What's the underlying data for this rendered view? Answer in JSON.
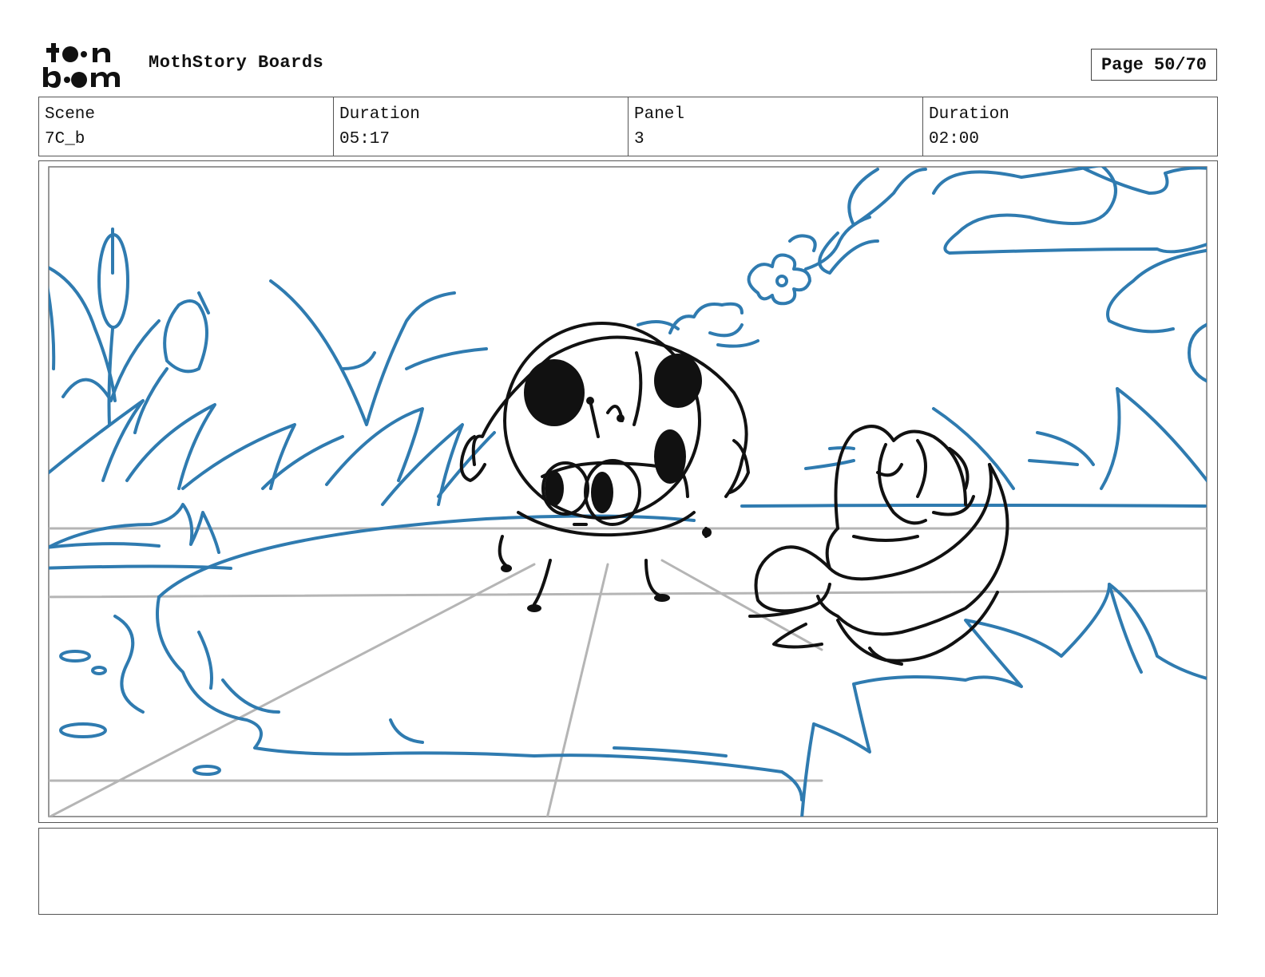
{
  "header": {
    "logo_text": [
      "toon",
      "boom"
    ],
    "title": "MothStory Boards",
    "page": "Page 50/70"
  },
  "info": {
    "scene_label": "Scene",
    "scene_value": "7C_b",
    "scene_duration_label": "Duration",
    "scene_duration_value": "05:17",
    "panel_label": "Panel",
    "panel_value": "3",
    "panel_duration_label": "Duration",
    "panel_duration_value": "02:00"
  },
  "notes": {
    "text": ""
  },
  "colors": {
    "background_sketch": "#2f7bb0",
    "character_ink": "#111111",
    "perspective_grid": "#b5b5b5"
  }
}
